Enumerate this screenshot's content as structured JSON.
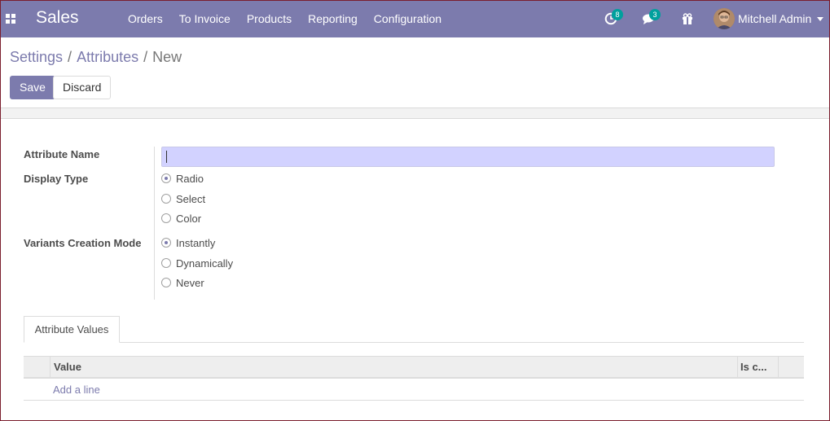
{
  "navbar": {
    "brand": "Sales",
    "menu": [
      "Orders",
      "To Invoice",
      "Products",
      "Reporting",
      "Configuration"
    ],
    "activity_count": "8",
    "messages_count": "3",
    "user_name": "Mitchell Admin",
    "color": "#7c7bad"
  },
  "breadcrumb": {
    "settings": "Settings",
    "attributes": "Attributes",
    "current": "New",
    "separator": "/"
  },
  "buttons": {
    "save": "Save",
    "discard": "Discard"
  },
  "form": {
    "attribute_name_label": "Attribute Name",
    "attribute_name_value": "",
    "display_type_label": "Display Type",
    "display_type_options": [
      "Radio",
      "Select",
      "Color"
    ],
    "display_type_selected": "Radio",
    "variants_label": "Variants Creation Mode",
    "variants_options": [
      "Instantly",
      "Dynamically",
      "Never"
    ],
    "variants_selected": "Instantly"
  },
  "notebook": {
    "tab_label": "Attribute Values",
    "columns": [
      "Value",
      "Is c..."
    ],
    "add_line": "Add a line"
  }
}
